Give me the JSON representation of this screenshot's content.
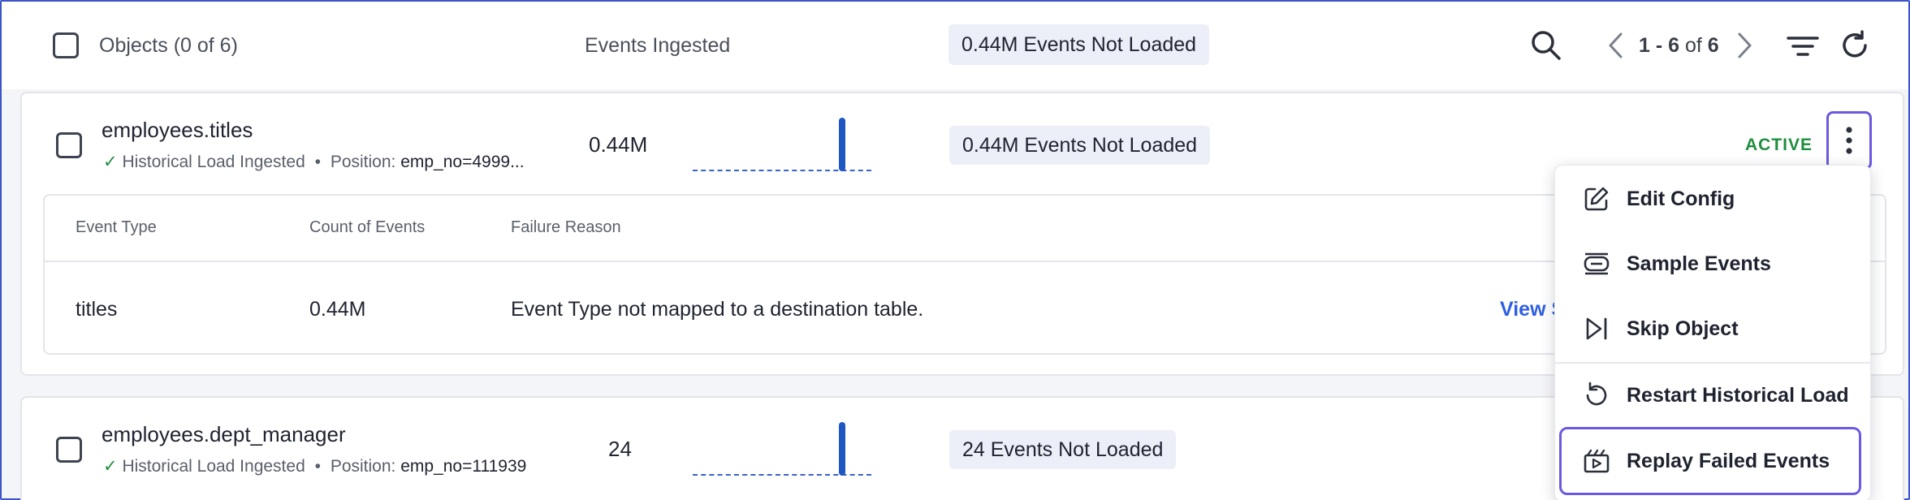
{
  "header": {
    "objects_label": "Objects (0 of 6)",
    "events_ingested_label": "Events Ingested",
    "not_loaded_badge": "0.44M Events Not Loaded",
    "pagination": {
      "range": "1 - 6",
      "of_text": "of",
      "total": "6"
    }
  },
  "rows": [
    {
      "name": "employees.titles",
      "status_text": "Historical Load Ingested",
      "position_label": "Position:",
      "position_value": "emp_no=4999...",
      "events": "0.44M",
      "not_loaded": "0.44M Events Not Loaded",
      "state": "ACTIVE"
    },
    {
      "name": "employees.dept_manager",
      "status_text": "Historical Load Ingested",
      "position_label": "Position:",
      "position_value": "emp_no=111939",
      "events": "24",
      "not_loaded": "24 Events Not Loaded"
    }
  ],
  "failures": {
    "columns": [
      "Event Type",
      "Count of Events",
      "Failure Reason"
    ],
    "rows": [
      {
        "event_type": "titles",
        "count": "0.44M",
        "reason": "Event Type not mapped to a destination table.",
        "link": "View S"
      }
    ]
  },
  "menu": {
    "items": [
      {
        "label": "Edit Config",
        "icon": "edit-icon"
      },
      {
        "label": "Sample Events",
        "icon": "sample-icon"
      },
      {
        "label": "Skip Object",
        "icon": "skip-icon"
      },
      {
        "label": "Restart Historical Load",
        "icon": "restart-icon"
      },
      {
        "label": "Replay Failed Events",
        "icon": "replay-icon"
      }
    ]
  },
  "colors": {
    "accent": "#6a5ae0",
    "active_green": "#1e8e3e",
    "link_blue": "#2f5fe0",
    "badge_bg": "#eceef8",
    "spark_blue": "#1e57c2"
  }
}
